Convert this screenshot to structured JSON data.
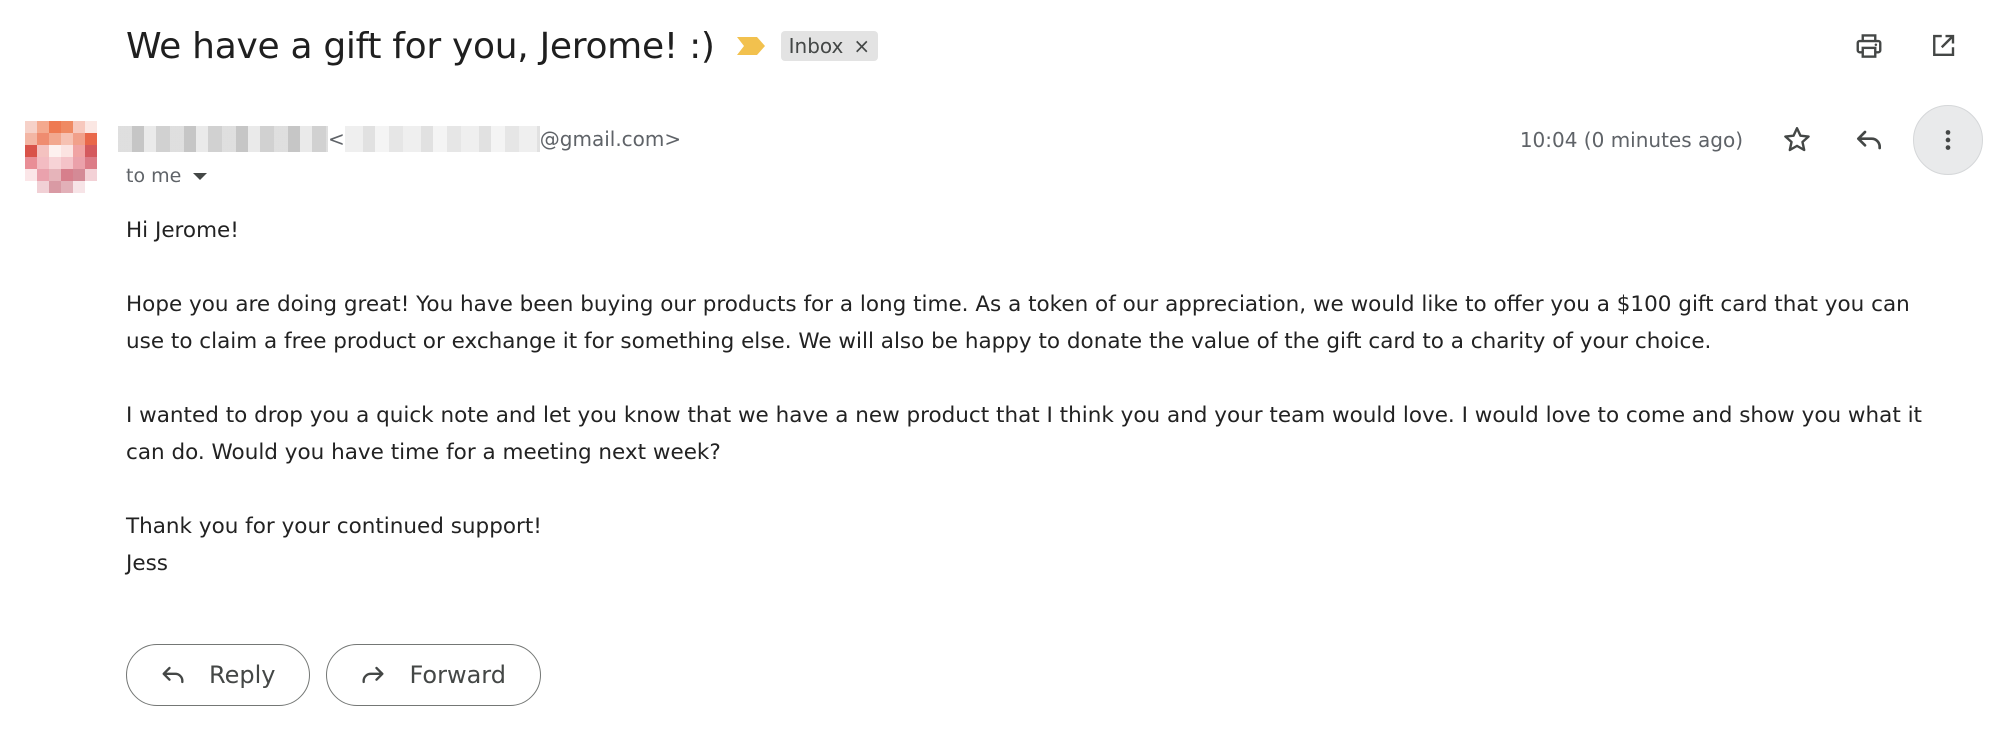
{
  "email": {
    "subject": "We have a gift for you, Jerome! :)",
    "label": "Inbox",
    "label_remove": "×",
    "sender_open": "<",
    "sender_email_suffix": "@gmail.com>",
    "recipient": "to me",
    "timestamp": "10:04 (0 minutes ago)",
    "body": {
      "greeting": "Hi Jerome!",
      "paragraph1": "Hope you are doing great! You have been buying our products for a long time. As a token of our appreciation, we would like to offer you a $100 gift card that you can use to claim a free product or exchange it for something else. We will also be happy to donate the value of the gift card to a charity of your choice.",
      "paragraph2": "I wanted to drop you a quick note and let you know that we have a new product that I think you and your team would love. I would love to come and show you what it can do. Would you have time for a meeting next week?",
      "closing": "Thank you for your continued support!",
      "signature": "Jess"
    }
  },
  "actions": {
    "reply_label": "Reply",
    "forward_label": "Forward"
  },
  "icons": {
    "importance": "importance-marker-icon",
    "print": "print-icon",
    "open_new_window": "open-in-new-window-icon",
    "star": "star-icon",
    "reply": "reply-icon",
    "more": "more-vertical-icon",
    "forward": "forward-icon"
  },
  "colors": {
    "importance": "#f2c14e",
    "chip_background": "#e3e3e3",
    "text": "#222222",
    "muted_text": "#5f6368"
  }
}
